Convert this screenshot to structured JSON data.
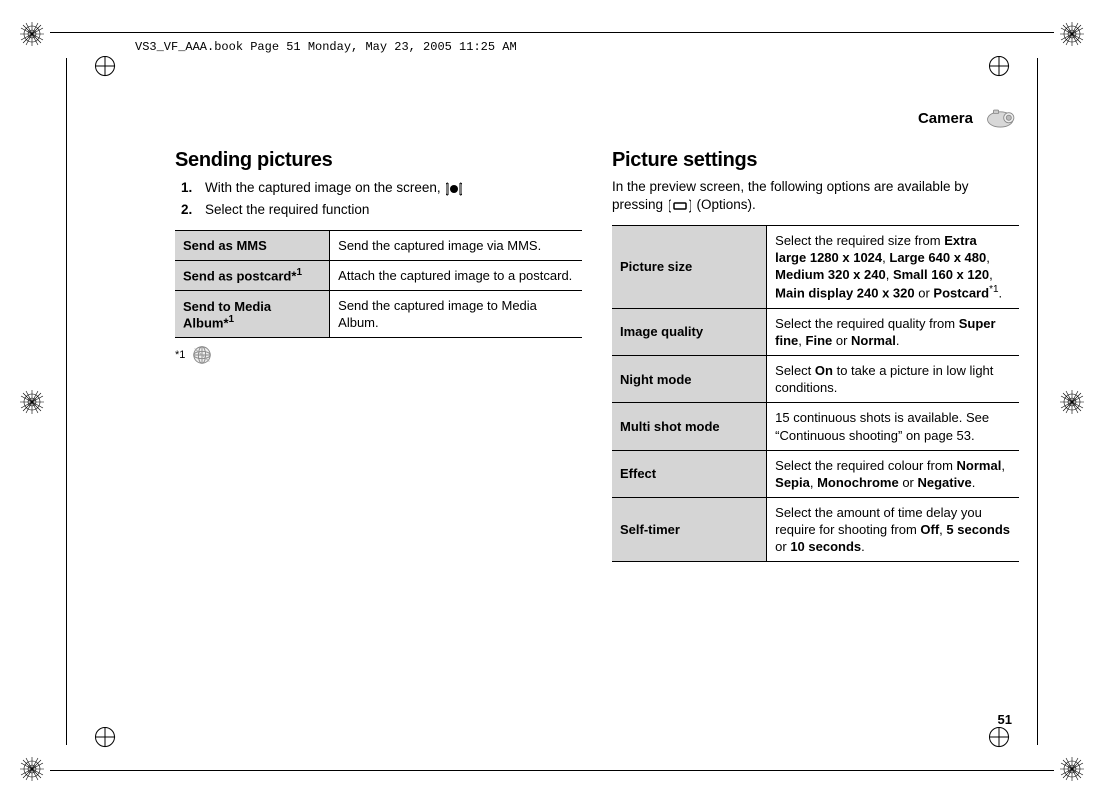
{
  "running_header": "VS3_VF_AAA.book  Page 51  Monday, May 23, 2005  11:25 AM",
  "header": {
    "section_title": "Camera"
  },
  "left": {
    "heading": "Sending pictures",
    "steps": [
      {
        "num": "1.",
        "text_before": "With the captured image on the screen, ",
        "icon_label": "centre-key"
      },
      {
        "num": "2.",
        "text": "Select the required function"
      }
    ],
    "table": [
      {
        "label": "Send as MMS",
        "desc": "Send the captured image via MMS."
      },
      {
        "label_html": "Send as postcard*<sup>1</sup>",
        "label_plain": "Send as postcard*1",
        "desc": "Attach the captured image to a postcard."
      },
      {
        "label_html": "Send to Media Album*<sup>1</sup>",
        "label_plain": "Send to Media Album*1",
        "desc": "Send the captured image to Media Album."
      }
    ],
    "footnote_marker": "*1"
  },
  "right": {
    "heading": "Picture settings",
    "intro_before": "In the preview screen, the following options are available by pressing ",
    "intro_after": " (Options).",
    "table": [
      {
        "label": "Picture size",
        "desc_parts": [
          "Select the required size from ",
          {
            "b": "Extra large 1280 x 1024"
          },
          ", ",
          {
            "b": "Large 640 x 480"
          },
          ", ",
          {
            "b": "Medium 320 x 240"
          },
          ", ",
          {
            "b": "Small 160 x 120"
          },
          ", ",
          {
            "b": "Main display 240 x 320"
          },
          " or ",
          {
            "b": "Postcard"
          },
          {
            "sup": "*1"
          },
          "."
        ]
      },
      {
        "label": "Image quality",
        "desc_parts": [
          "Select the required quality from ",
          {
            "b": "Super fine"
          },
          ", ",
          {
            "b": "Fine"
          },
          " or ",
          {
            "b": "Normal"
          },
          "."
        ]
      },
      {
        "label": "Night mode",
        "desc_parts": [
          "Select ",
          {
            "b": "On"
          },
          " to take a picture in low light conditions."
        ]
      },
      {
        "label": "Multi shot mode",
        "desc_parts": [
          "15 continuous shots is available. See “Continuous shooting” on page 53."
        ]
      },
      {
        "label": "Effect",
        "desc_parts": [
          "Select the required colour from ",
          {
            "b": "Normal"
          },
          ", ",
          {
            "b": "Sepia"
          },
          ", ",
          {
            "b": "Monochrome"
          },
          " or ",
          {
            "b": "Negative"
          },
          "."
        ]
      },
      {
        "label": "Self-timer",
        "desc_parts": [
          "Select the amount of time delay you require for shooting from ",
          {
            "b": "Off"
          },
          ", ",
          {
            "b": "5 seconds"
          },
          " or ",
          {
            "b": "10 seconds"
          },
          "."
        ]
      }
    ]
  },
  "page_number": "51"
}
